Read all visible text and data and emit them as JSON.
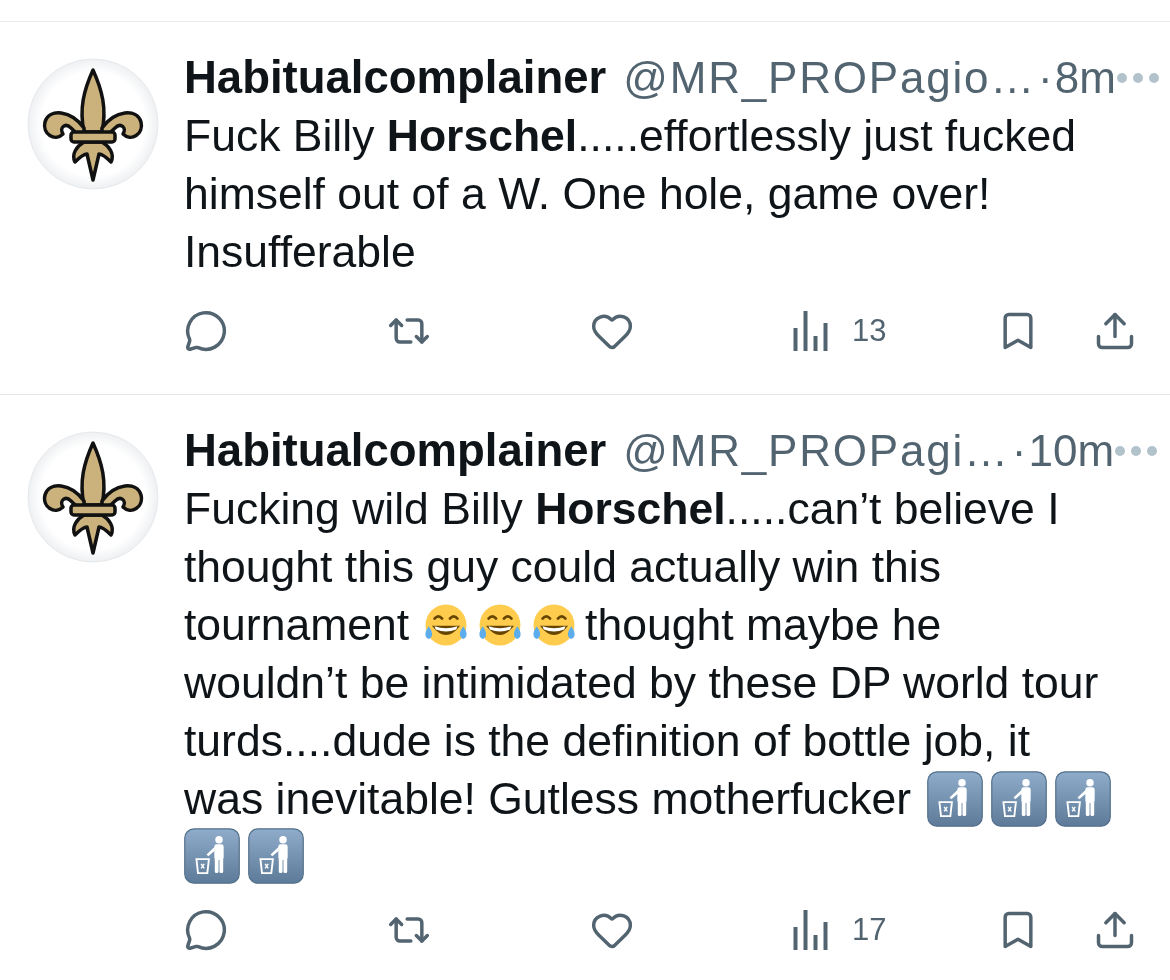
{
  "tweets": [
    {
      "author": "Habitualcomplainer",
      "handle": "@MR_PROPagio…",
      "separator": "·",
      "time": "8m",
      "body": [
        {
          "kind": "text",
          "text": "Fuck Billy **Horschel**.....effortlessly just fucked himself out of a W. One hole, game over! Insufferable"
        }
      ],
      "actions": [
        {
          "kind": "reply"
        },
        {
          "kind": "repost"
        },
        {
          "kind": "like"
        },
        {
          "kind": "views",
          "count": "13"
        },
        {
          "kind": "bookmark"
        },
        {
          "kind": "share"
        }
      ]
    },
    {
      "author": "Habitualcomplainer",
      "handle": "@MR_PROPagi…",
      "separator": "·",
      "time": "10m",
      "body": [
        {
          "kind": "text",
          "text": "Fucking wild Billy **Horschel**.....can’t believe I thought this guy could actually win this"
        },
        {
          "kind": "text",
          "text": "tournament"
        },
        {
          "kind": "laughing"
        },
        {
          "kind": "laughing"
        },
        {
          "kind": "laughing"
        },
        {
          "kind": "text",
          "text": "thought maybe he"
        },
        {
          "kind": "text",
          "text": "wouldn’t be intimidated by these DP world tour"
        },
        {
          "kind": "text",
          "text": "turds....dude is the definition of bottle job, it"
        },
        {
          "kind": "text",
          "text": "was inevitable! Gutless motherfucker"
        },
        {
          "kind": "litter"
        },
        {
          "kind": "litter"
        },
        {
          "kind": "litter"
        },
        {
          "kind": "litter"
        },
        {
          "kind": "litter"
        }
      ],
      "actions": [
        {
          "kind": "reply"
        },
        {
          "kind": "repost"
        },
        {
          "kind": "like"
        },
        {
          "kind": "views",
          "count": "17"
        },
        {
          "kind": "bookmark"
        },
        {
          "kind": "share"
        }
      ]
    }
  ]
}
